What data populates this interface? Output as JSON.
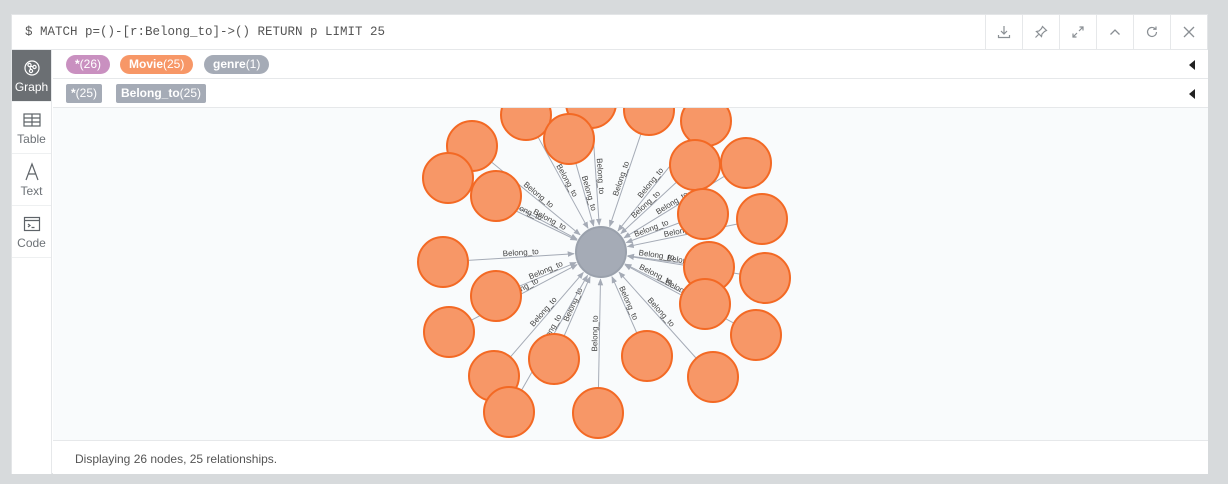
{
  "query": "$ MATCH p=()-[r:Belong_to]->() RETURN p LIMIT 25",
  "toolbar": {
    "actions": [
      "download-icon",
      "pin-icon",
      "expand-icon",
      "collapse-up-icon",
      "refresh-icon",
      "close-icon"
    ]
  },
  "sidebar": {
    "items": [
      {
        "label": "Graph",
        "icon": "graph-icon",
        "active": true
      },
      {
        "label": "Table",
        "icon": "table-icon",
        "active": false
      },
      {
        "label": "Text",
        "icon": "text-icon",
        "active": false
      },
      {
        "label": "Code",
        "icon": "code-icon",
        "active": false
      }
    ]
  },
  "labels_bar": {
    "all": {
      "name": "*",
      "count": "(26)",
      "color": "#c990c0"
    },
    "movie": {
      "name": "Movie",
      "count": "(25)",
      "color": "#f79767"
    },
    "genre": {
      "name": "genre",
      "count": "(1)",
      "color": "#a5abb6"
    }
  },
  "rels_bar": {
    "all": {
      "name": "*",
      "count": "(25)",
      "color": "#a5abb6"
    },
    "belong_to": {
      "name": "Belong_to",
      "count": "(25)",
      "color": "#a5abb6"
    }
  },
  "graph": {
    "relationship_label": "Belong_to",
    "center_color": "#a5abb6",
    "node_color": "#f79767",
    "node_stroke": "#f36924",
    "movie_count": 25
  },
  "status": "Displaying 26 nodes, 25 relationships."
}
